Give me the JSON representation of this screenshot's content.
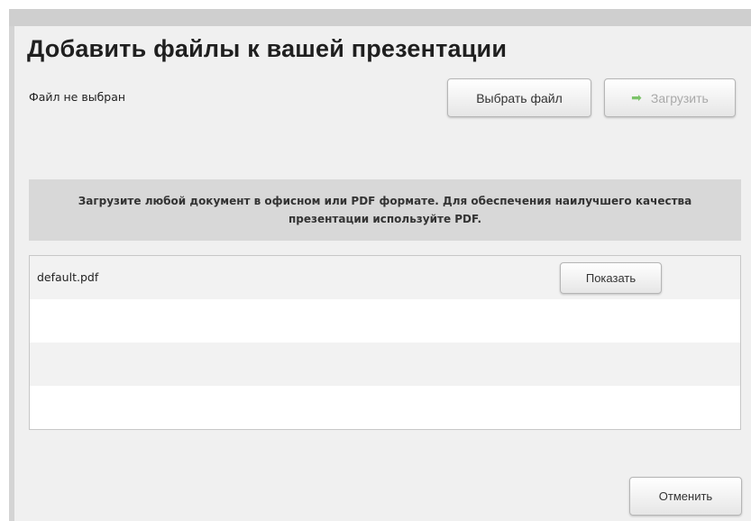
{
  "dialog": {
    "title": "Добавить файлы к вашей презентации",
    "file_status": "Файл не выбран",
    "choose_button_label": "Выбрать файл",
    "upload_button_label": "Загрузить",
    "info_text": "Загрузите любой документ в офисном или PDF формате. Для обеспечения наилучшего качества презентации используйте PDF.",
    "files": [
      {
        "name": "default.pdf",
        "action_label": "Показать"
      }
    ],
    "cancel_button_label": "Отменить"
  },
  "colors": {
    "dialog_bg": "#f0f0f0",
    "info_bg": "#d8d8d8",
    "upload_arrow": "#7cc36a",
    "disabled_text": "#a9a9a9"
  },
  "icons": {
    "upload": "right-arrow-icon"
  }
}
